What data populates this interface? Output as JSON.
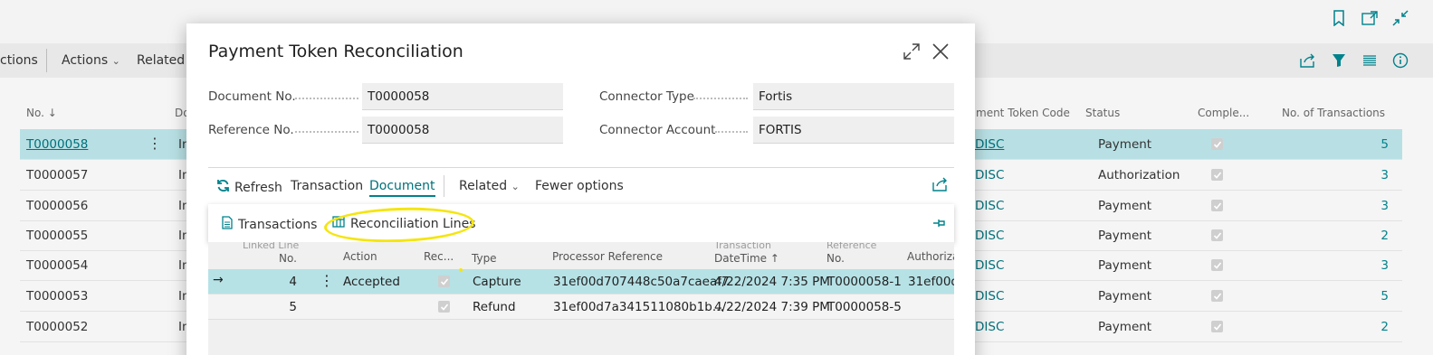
{
  "background": {
    "toolbar": {
      "actions_partial": "ctions",
      "actions": "Actions",
      "related": "Related"
    },
    "list": {
      "headers": {
        "no": "No.",
        "doc_partial": "Do",
        "token_code_partial": "ment Token Code",
        "status": "Status",
        "completed": "Comple...",
        "transactions": "No. of Transactions"
      },
      "rows": [
        {
          "no": "T0000058",
          "doc": "In",
          "code": "DISC",
          "status": "Payment",
          "count": "5"
        },
        {
          "no": "T0000057",
          "doc": "In",
          "code": "DISC",
          "status": "Authorization",
          "count": "3"
        },
        {
          "no": "T0000056",
          "doc": "In",
          "code": "DISC",
          "status": "Payment",
          "count": "3"
        },
        {
          "no": "T0000055",
          "doc": "In",
          "code": "DISC",
          "status": "Payment",
          "count": "2"
        },
        {
          "no": "T0000054",
          "doc": "In",
          "code": "DISC",
          "status": "Payment",
          "count": "3"
        },
        {
          "no": "T0000053",
          "doc": "In",
          "code": "DISC",
          "status": "Payment",
          "count": "5"
        },
        {
          "no": "T0000052",
          "doc": "In",
          "code": "DISC",
          "status": "Payment",
          "count": "2"
        }
      ]
    }
  },
  "dialog": {
    "title": "Payment Token Reconciliation",
    "fields": {
      "document_no_label": "Document No.",
      "document_no_value": "T0000058",
      "reference_no_label": "Reference No.",
      "reference_no_value": "T0000058",
      "connector_type_label": "Connector Type",
      "connector_type_value": "Fortis",
      "connector_account_label": "Connector Account",
      "connector_account_value": "FORTIS"
    },
    "actions": {
      "refresh": "Refresh",
      "transaction": "Transaction",
      "document": "Document",
      "related": "Related",
      "fewer_options": "Fewer options"
    },
    "subactions": {
      "transactions": "Transactions",
      "reconciliation_lines": "Reconciliation Lines"
    },
    "grid": {
      "headers": {
        "linked_line_top": "Linked Line",
        "linked_line_bottom": "No.",
        "action": "Action",
        "rec": "Rec...",
        "type": "Type",
        "processor_reference": "Processor Reference",
        "datetime_top": "Transaction",
        "datetime_bottom": "DateTime",
        "reference_top": "Reference",
        "reference_bottom": "No.",
        "authorization": "Authoriza"
      },
      "rows": [
        {
          "line": "4",
          "action": "Accepted",
          "type": "Capture",
          "processor_ref": "31ef00d707448c50a7caeaf7",
          "datetime": "4/22/2024 7:35 PM",
          "reference": "T0000058-1",
          "auth": "31ef00d"
        },
        {
          "line": "5",
          "action": "",
          "type": "Refund",
          "processor_ref": "31ef00d7a341511080b1b...",
          "datetime": "4/22/2024 7:39 PM",
          "reference": "T0000058-5",
          "auth": ""
        }
      ]
    }
  },
  "colors": {
    "accent": "#00828c",
    "selected_row": "#b8e0e4",
    "annotation": "#f5e50f"
  }
}
